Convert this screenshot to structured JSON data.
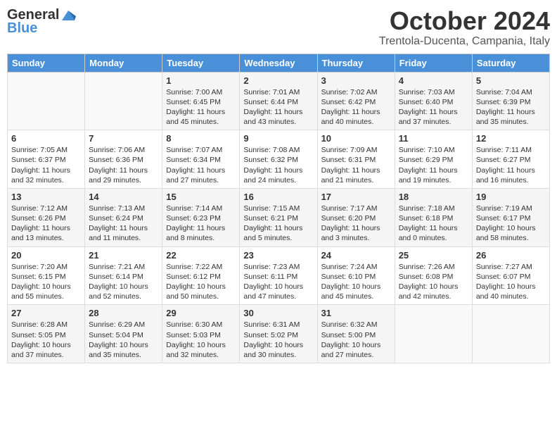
{
  "header": {
    "logo_general": "General",
    "logo_blue": "Blue",
    "month": "October 2024",
    "location": "Trentola-Ducenta, Campania, Italy"
  },
  "weekdays": [
    "Sunday",
    "Monday",
    "Tuesday",
    "Wednesday",
    "Thursday",
    "Friday",
    "Saturday"
  ],
  "weeks": [
    [
      {
        "day": "",
        "sunrise": "",
        "sunset": "",
        "daylight": ""
      },
      {
        "day": "",
        "sunrise": "",
        "sunset": "",
        "daylight": ""
      },
      {
        "day": "1",
        "sunrise": "Sunrise: 7:00 AM",
        "sunset": "Sunset: 6:45 PM",
        "daylight": "Daylight: 11 hours and 45 minutes."
      },
      {
        "day": "2",
        "sunrise": "Sunrise: 7:01 AM",
        "sunset": "Sunset: 6:44 PM",
        "daylight": "Daylight: 11 hours and 43 minutes."
      },
      {
        "day": "3",
        "sunrise": "Sunrise: 7:02 AM",
        "sunset": "Sunset: 6:42 PM",
        "daylight": "Daylight: 11 hours and 40 minutes."
      },
      {
        "day": "4",
        "sunrise": "Sunrise: 7:03 AM",
        "sunset": "Sunset: 6:40 PM",
        "daylight": "Daylight: 11 hours and 37 minutes."
      },
      {
        "day": "5",
        "sunrise": "Sunrise: 7:04 AM",
        "sunset": "Sunset: 6:39 PM",
        "daylight": "Daylight: 11 hours and 35 minutes."
      }
    ],
    [
      {
        "day": "6",
        "sunrise": "Sunrise: 7:05 AM",
        "sunset": "Sunset: 6:37 PM",
        "daylight": "Daylight: 11 hours and 32 minutes."
      },
      {
        "day": "7",
        "sunrise": "Sunrise: 7:06 AM",
        "sunset": "Sunset: 6:36 PM",
        "daylight": "Daylight: 11 hours and 29 minutes."
      },
      {
        "day": "8",
        "sunrise": "Sunrise: 7:07 AM",
        "sunset": "Sunset: 6:34 PM",
        "daylight": "Daylight: 11 hours and 27 minutes."
      },
      {
        "day": "9",
        "sunrise": "Sunrise: 7:08 AM",
        "sunset": "Sunset: 6:32 PM",
        "daylight": "Daylight: 11 hours and 24 minutes."
      },
      {
        "day": "10",
        "sunrise": "Sunrise: 7:09 AM",
        "sunset": "Sunset: 6:31 PM",
        "daylight": "Daylight: 11 hours and 21 minutes."
      },
      {
        "day": "11",
        "sunrise": "Sunrise: 7:10 AM",
        "sunset": "Sunset: 6:29 PM",
        "daylight": "Daylight: 11 hours and 19 minutes."
      },
      {
        "day": "12",
        "sunrise": "Sunrise: 7:11 AM",
        "sunset": "Sunset: 6:27 PM",
        "daylight": "Daylight: 11 hours and 16 minutes."
      }
    ],
    [
      {
        "day": "13",
        "sunrise": "Sunrise: 7:12 AM",
        "sunset": "Sunset: 6:26 PM",
        "daylight": "Daylight: 11 hours and 13 minutes."
      },
      {
        "day": "14",
        "sunrise": "Sunrise: 7:13 AM",
        "sunset": "Sunset: 6:24 PM",
        "daylight": "Daylight: 11 hours and 11 minutes."
      },
      {
        "day": "15",
        "sunrise": "Sunrise: 7:14 AM",
        "sunset": "Sunset: 6:23 PM",
        "daylight": "Daylight: 11 hours and 8 minutes."
      },
      {
        "day": "16",
        "sunrise": "Sunrise: 7:15 AM",
        "sunset": "Sunset: 6:21 PM",
        "daylight": "Daylight: 11 hours and 5 minutes."
      },
      {
        "day": "17",
        "sunrise": "Sunrise: 7:17 AM",
        "sunset": "Sunset: 6:20 PM",
        "daylight": "Daylight: 11 hours and 3 minutes."
      },
      {
        "day": "18",
        "sunrise": "Sunrise: 7:18 AM",
        "sunset": "Sunset: 6:18 PM",
        "daylight": "Daylight: 11 hours and 0 minutes."
      },
      {
        "day": "19",
        "sunrise": "Sunrise: 7:19 AM",
        "sunset": "Sunset: 6:17 PM",
        "daylight": "Daylight: 10 hours and 58 minutes."
      }
    ],
    [
      {
        "day": "20",
        "sunrise": "Sunrise: 7:20 AM",
        "sunset": "Sunset: 6:15 PM",
        "daylight": "Daylight: 10 hours and 55 minutes."
      },
      {
        "day": "21",
        "sunrise": "Sunrise: 7:21 AM",
        "sunset": "Sunset: 6:14 PM",
        "daylight": "Daylight: 10 hours and 52 minutes."
      },
      {
        "day": "22",
        "sunrise": "Sunrise: 7:22 AM",
        "sunset": "Sunset: 6:12 PM",
        "daylight": "Daylight: 10 hours and 50 minutes."
      },
      {
        "day": "23",
        "sunrise": "Sunrise: 7:23 AM",
        "sunset": "Sunset: 6:11 PM",
        "daylight": "Daylight: 10 hours and 47 minutes."
      },
      {
        "day": "24",
        "sunrise": "Sunrise: 7:24 AM",
        "sunset": "Sunset: 6:10 PM",
        "daylight": "Daylight: 10 hours and 45 minutes."
      },
      {
        "day": "25",
        "sunrise": "Sunrise: 7:26 AM",
        "sunset": "Sunset: 6:08 PM",
        "daylight": "Daylight: 10 hours and 42 minutes."
      },
      {
        "day": "26",
        "sunrise": "Sunrise: 7:27 AM",
        "sunset": "Sunset: 6:07 PM",
        "daylight": "Daylight: 10 hours and 40 minutes."
      }
    ],
    [
      {
        "day": "27",
        "sunrise": "Sunrise: 6:28 AM",
        "sunset": "Sunset: 5:05 PM",
        "daylight": "Daylight: 10 hours and 37 minutes."
      },
      {
        "day": "28",
        "sunrise": "Sunrise: 6:29 AM",
        "sunset": "Sunset: 5:04 PM",
        "daylight": "Daylight: 10 hours and 35 minutes."
      },
      {
        "day": "29",
        "sunrise": "Sunrise: 6:30 AM",
        "sunset": "Sunset: 5:03 PM",
        "daylight": "Daylight: 10 hours and 32 minutes."
      },
      {
        "day": "30",
        "sunrise": "Sunrise: 6:31 AM",
        "sunset": "Sunset: 5:02 PM",
        "daylight": "Daylight: 10 hours and 30 minutes."
      },
      {
        "day": "31",
        "sunrise": "Sunrise: 6:32 AM",
        "sunset": "Sunset: 5:00 PM",
        "daylight": "Daylight: 10 hours and 27 minutes."
      },
      {
        "day": "",
        "sunrise": "",
        "sunset": "",
        "daylight": ""
      },
      {
        "day": "",
        "sunrise": "",
        "sunset": "",
        "daylight": ""
      }
    ]
  ]
}
